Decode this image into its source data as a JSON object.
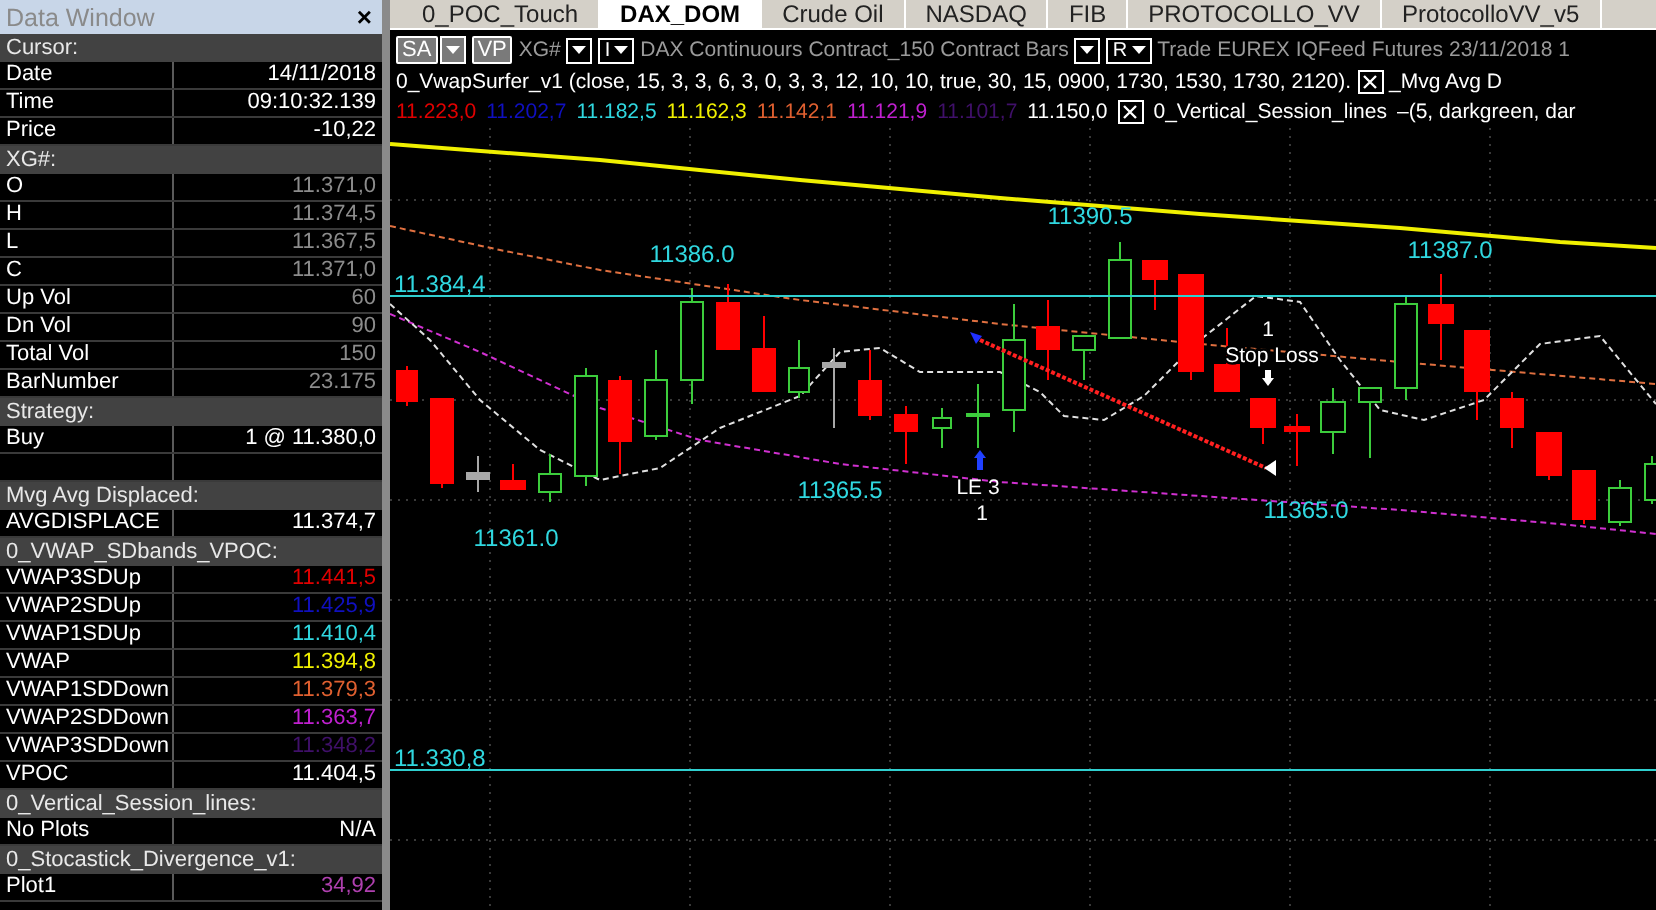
{
  "data_window": {
    "title": "Data Window",
    "close": "×",
    "rows": [
      {
        "kind": "section",
        "label": "Cursor:"
      },
      {
        "kind": "value",
        "label": "Date",
        "value": "14/11/2018",
        "color": "#ffffff"
      },
      {
        "kind": "value",
        "label": "Time",
        "value": "09:10:32.139",
        "color": "#ffffff"
      },
      {
        "kind": "value",
        "label": "Price",
        "value": "-10,22",
        "color": "#ffffff"
      },
      {
        "kind": "section",
        "label": "XG#:"
      },
      {
        "kind": "value",
        "label": "O",
        "value": "11.371,0",
        "color": "#8c8c8c"
      },
      {
        "kind": "value",
        "label": "H",
        "value": "11.374,5",
        "color": "#8c8c8c"
      },
      {
        "kind": "value",
        "label": "L",
        "value": "11.367,5",
        "color": "#8c8c8c"
      },
      {
        "kind": "value",
        "label": "C",
        "value": "11.371,0",
        "color": "#8c8c8c"
      },
      {
        "kind": "value",
        "label": "Up Vol",
        "value": "60",
        "color": "#8c8c8c"
      },
      {
        "kind": "value",
        "label": "Dn Vol",
        "value": "90",
        "color": "#8c8c8c"
      },
      {
        "kind": "value",
        "label": "Total Vol",
        "value": "150",
        "color": "#8c8c8c"
      },
      {
        "kind": "value",
        "label": "BarNumber",
        "value": "23.175",
        "color": "#8c8c8c"
      },
      {
        "kind": "section",
        "label": "Strategy:"
      },
      {
        "kind": "value",
        "label": "Buy",
        "value": "1 @ 11.380,0",
        "color": "#ffffff"
      },
      {
        "kind": "blank"
      },
      {
        "kind": "section",
        "label": "Mvg Avg Displaced:"
      },
      {
        "kind": "value",
        "label": "AVGDISPLACE",
        "value": "11.374,7",
        "color": "#ffffff"
      },
      {
        "kind": "section",
        "label": "0_VWAP_SDbands_VPOC:"
      },
      {
        "kind": "value",
        "label": "VWAP3SDUp",
        "value": "11.441,5",
        "color": "#e00000"
      },
      {
        "kind": "value",
        "label": "VWAP2SDUp",
        "value": "11.425,9",
        "color": "#1010c0"
      },
      {
        "kind": "value",
        "label": "VWAP1SDUp",
        "value": "11.410,4",
        "color": "#30d8e0"
      },
      {
        "kind": "value",
        "label": "VWAP",
        "value": "11.394,8",
        "color": "#f0f000"
      },
      {
        "kind": "value",
        "label": "VWAP1SDDown",
        "value": "11.379,3",
        "color": "#e06030"
      },
      {
        "kind": "value",
        "label": "VWAP2SDDown",
        "value": "11.363,7",
        "color": "#c020d0"
      },
      {
        "kind": "value",
        "label": "VWAP3SDDown",
        "value": "11.348,2",
        "color": "#40106a"
      },
      {
        "kind": "value",
        "label": "VPOC",
        "value": "11.404,5",
        "color": "#ffffff"
      },
      {
        "kind": "section",
        "label": "0_Vertical_Session_lines:"
      },
      {
        "kind": "value",
        "label": "No Plots",
        "value": "N/A",
        "color": "#ffffff"
      },
      {
        "kind": "section",
        "label": "0_Stocastick_Divergence_v1:"
      },
      {
        "kind": "value",
        "label": "Plot1",
        "value": "34,92",
        "color": "#b040b0"
      }
    ]
  },
  "tabs": [
    {
      "label": "0_POC_Touch",
      "selected": false
    },
    {
      "label": "DAX_DOM",
      "selected": true
    },
    {
      "label": "Crude Oil",
      "selected": false
    },
    {
      "label": "NASDAQ",
      "selected": false
    },
    {
      "label": "FIB",
      "selected": false
    },
    {
      "label": "PROTOCOLLO_VV",
      "selected": false
    },
    {
      "label": "ProtocolloVV_v5",
      "selected": false
    }
  ],
  "toolbar": [
    {
      "kind": "combo",
      "label": "SA"
    },
    {
      "kind": "button",
      "label": "VP"
    },
    {
      "kind": "text",
      "label": "XG#"
    },
    {
      "kind": "dropdown"
    },
    {
      "kind": "dropdown",
      "label": "I"
    },
    {
      "kind": "text",
      "label": "DAX Continuours Contract_150 Contract Bars"
    },
    {
      "kind": "dropdown"
    },
    {
      "kind": "dropdown",
      "label": "R"
    },
    {
      "kind": "text",
      "label": "Trade"
    },
    {
      "kind": "text",
      "label": "EUREX"
    },
    {
      "kind": "text",
      "label": "IQFeed"
    },
    {
      "kind": "text",
      "label": "Futures"
    },
    {
      "kind": "text",
      "label": "23/11/2018 1"
    }
  ],
  "indicator_line": [
    {
      "kind": "text",
      "label": "0_VwapSurfer_v1 (close, 15, 3, 3, 6, 3, 0, 3, 3, 12, 10, 10, true, 30, 15, 0900, 1730, 1530, 1730, 2120)."
    },
    {
      "kind": "close"
    },
    {
      "kind": "text",
      "label": "_Mvg Avg D"
    }
  ],
  "values_line": [
    {
      "kind": "value",
      "label": "11.223,0",
      "color": "#e00000"
    },
    {
      "kind": "value",
      "label": "11.202,7",
      "color": "#1010c0"
    },
    {
      "kind": "value",
      "label": "11.182,5",
      "color": "#30d8e0"
    },
    {
      "kind": "value",
      "label": "11.162,3",
      "color": "#f0f000"
    },
    {
      "kind": "value",
      "label": "11.142,1",
      "color": "#e06030"
    },
    {
      "kind": "value",
      "label": "11.121,9",
      "color": "#c020d0"
    },
    {
      "kind": "value",
      "label": "11.101,7",
      "color": "#40106a"
    },
    {
      "kind": "value",
      "label": "11.150,0",
      "color": "#ffffff"
    },
    {
      "kind": "close"
    },
    {
      "kind": "text",
      "label": "0_Vertical_Session_lines"
    },
    {
      "kind": "text",
      "label": "–(5, darkgreen, dar"
    }
  ],
  "chart": {
    "level_lines": [
      {
        "label": "11.384,4"
      },
      {
        "label": "11.330,8"
      }
    ],
    "swing_labels": [
      "11386.0",
      "11390.5",
      "11387.0",
      "11365.5",
      "11361.0",
      "11365.0"
    ],
    "trade_marks": [
      {
        "kind": "entry",
        "label": "LE 3",
        "quantity": "1"
      },
      {
        "kind": "exit",
        "label": "Stop Loss",
        "quantity": "1"
      }
    ]
  }
}
